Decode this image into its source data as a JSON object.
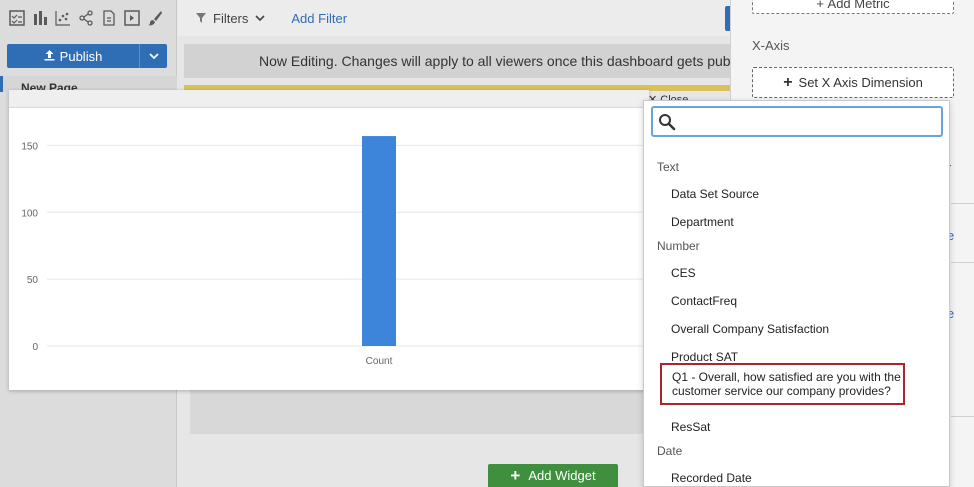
{
  "left_rail": {
    "publish_label": "Publish",
    "page_tab_label": "New Page"
  },
  "main": {
    "filters_label": "Filters",
    "add_filter_label": "Add Filter",
    "editing_banner": "Now Editing. Changes will apply to all viewers once this dashboard gets published.",
    "add_widget_label": "Add Widget"
  },
  "right_panel": {
    "add_metric_label": "Add Metric",
    "x_axis_label": "X-Axis",
    "set_x_axis_label": "Set X Axis Dimension"
  },
  "chart_modal": {
    "close_label": "Close"
  },
  "chart_data": {
    "type": "bar",
    "categories": [
      "Count"
    ],
    "values": [
      157
    ],
    "ylim": [
      0,
      175
    ],
    "yticks": [
      0,
      50,
      100,
      150
    ],
    "grid": true,
    "bar_color": "#3d85db"
  },
  "dropdown": {
    "search_placeholder": "",
    "groups": [
      {
        "label": "Text",
        "items": [
          "Data Set Source",
          "Department"
        ]
      },
      {
        "label": "Number",
        "items": [
          "CES",
          "ContactFreq",
          "Overall Company Satisfaction",
          "Product SAT",
          "Q1 - Overall, how satisfied are you with the customer service our company provides?",
          "ResSat"
        ]
      },
      {
        "label": "Date",
        "items": [
          "Recorded Date"
        ]
      }
    ],
    "highlight_color": "#a8262c"
  },
  "colors": {
    "accent": "#2f6db5",
    "add_widget": "#3f8f3f",
    "search_focus": "#6aa2db"
  }
}
